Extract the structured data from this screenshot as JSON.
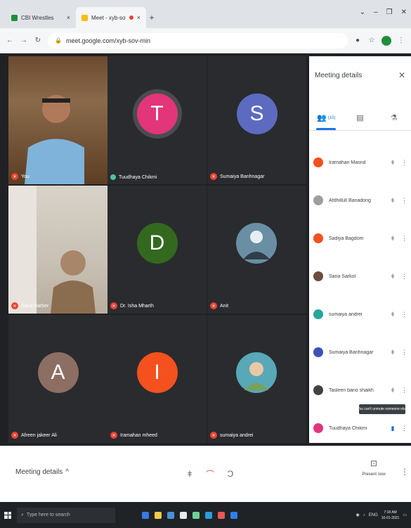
{
  "browser": {
    "tabs": [
      {
        "title": "CBI Wrestles",
        "favicon_color": "#1e8e3e"
      },
      {
        "title": "Meet - xyb-sov-min",
        "favicon_color": "#fbbc04"
      }
    ],
    "tab_close": "×",
    "new_tab": "+",
    "url": "meet.google.com/xyb-sov-min",
    "window_controls": [
      "⌄",
      "–",
      "❐",
      "✕"
    ]
  },
  "tiles": [
    {
      "type": "video",
      "name": "You",
      "mic": "off"
    },
    {
      "type": "avatar",
      "initial": "T",
      "color": "#e2357a",
      "ring": "#5f6368",
      "name": "Tuudhaya Chikmi",
      "mic": "speaking"
    },
    {
      "type": "avatar",
      "initial": "S",
      "color": "#5c6bc0",
      "name": "Sumaiya Banhnagar",
      "mic": "off"
    },
    {
      "type": "video",
      "name": "Sana Barber",
      "mic": "off"
    },
    {
      "type": "avatar",
      "initial": "D",
      "color": "#33691e",
      "name": "Dr. Isha Mharth",
      "mic": "off"
    },
    {
      "type": "photo",
      "photo_color": "#6a8fa5",
      "name": "Anit",
      "mic": "off"
    },
    {
      "type": "avatar",
      "initial": "A",
      "color": "#8d6e63",
      "name": "Afreen jakeer Ali",
      "mic": "off"
    },
    {
      "type": "avatar",
      "initial": "I",
      "color": "#f4511e",
      "name": "Iramahan mheed",
      "mic": "off"
    },
    {
      "type": "photo",
      "photo_color": "#58a8b8",
      "name": "sumaiya andrei",
      "mic": "off"
    }
  ],
  "panel": {
    "title": "Meeting details",
    "close": "✕",
    "tabs": [
      {
        "icon": "people",
        "label": "👥",
        "count": "(10)"
      },
      {
        "icon": "chat",
        "label": "▤",
        "count": ""
      },
      {
        "icon": "activities",
        "label": "⚗",
        "count": ""
      }
    ],
    "participants": [
      {
        "name": "Iramahan Masnd",
        "color": "#f4511e"
      },
      {
        "name": "Afdhillull Banadong",
        "color": "#9e9e9e"
      },
      {
        "name": "Sadiya Bagdom",
        "color": "#f4511e"
      },
      {
        "name": "Sana Sarkol",
        "color": "#6d4c41"
      },
      {
        "name": "sumaiya andrei",
        "color": "#26a69a"
      },
      {
        "name": "Sumaiya Banhnagar",
        "color": "#3f51b5"
      },
      {
        "name": "Tasleen bano shaikh",
        "color": "#424242"
      },
      {
        "name": "Tuudhaya Chikmi",
        "color": "#e2357a"
      }
    ],
    "mic_glyph": "🎙",
    "more_glyph": "⋮",
    "tooltip": "You can't unmute someone else"
  },
  "controls": {
    "meeting_details_label": "Meeting details",
    "chevron": "^",
    "mic_glyph": "🎙",
    "end_glyph": "☎",
    "cc_glyph": "⊏",
    "present_label": "Present now",
    "present_glyph": "⊡",
    "more_glyph": "⋮"
  },
  "taskbar": {
    "search_placeholder": "Type here to search",
    "app_colors": [
      "#3b78e7",
      "#f2c94c",
      "#4a90d9",
      "#e8eaed",
      "#6fcf97",
      "#2d9cdb",
      "#eb5757",
      "#2f80ed"
    ],
    "time": "7:18 AM",
    "date": "10-01-2021",
    "language": "ENG"
  }
}
